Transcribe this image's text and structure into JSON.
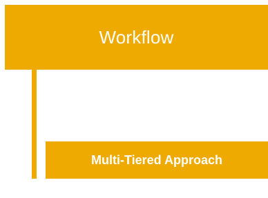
{
  "colors": {
    "accent": "#EEAA00",
    "text_on_accent": "#FFFFFF",
    "background": "#FFFFFF"
  },
  "diagram": {
    "header": {
      "label": "Workflow"
    },
    "steps": [
      {
        "label": "Multi-Tiered Approach"
      }
    ]
  }
}
